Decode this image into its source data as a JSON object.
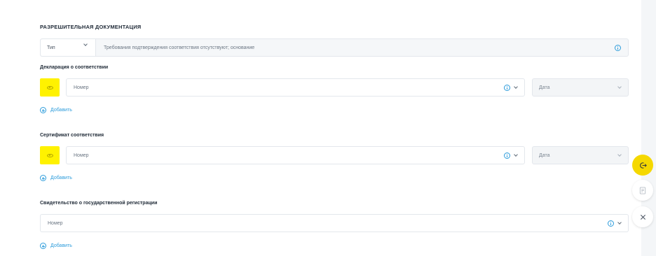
{
  "section": {
    "title": "РАЗРЕШИТЕЛЬНАЯ ДОКУМЕНТАЦИЯ"
  },
  "type_row": {
    "select_value": "Тип",
    "text": "Требования подтверждения соответствия отсутствуют; основание"
  },
  "declaration": {
    "label": "Декларация о соответствии",
    "number_placeholder": "Номер",
    "date_placeholder": "Дата",
    "add_label": "Добавить"
  },
  "certificate": {
    "label": "Сертификат соответствия",
    "number_placeholder": "Номер",
    "date_placeholder": "Дата",
    "add_label": "Добавить"
  },
  "registration": {
    "label": "Свидетельство о государственной регистрации",
    "number_placeholder": "Номер",
    "add_label": "Добавить"
  },
  "colors": {
    "accent": "#2d9cdb",
    "highlight": "#fff200",
    "fab_primary": "#f5d800"
  },
  "icons": [
    "eye-icon",
    "info-icon",
    "chevron-down-icon",
    "plus-circle-icon",
    "logout-icon",
    "document-icon",
    "close-icon"
  ]
}
